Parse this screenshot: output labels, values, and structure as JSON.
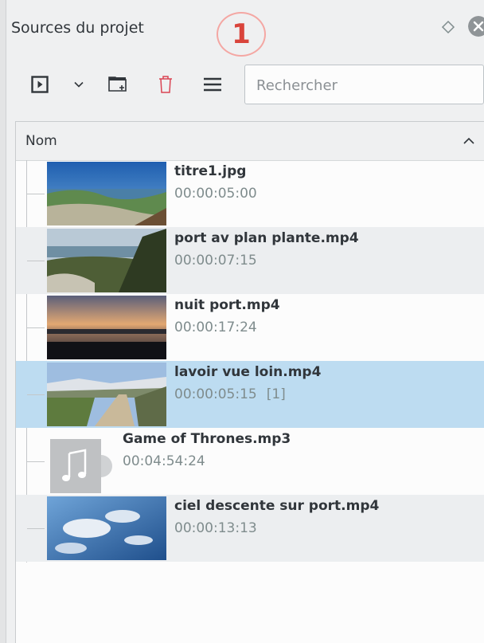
{
  "panel": {
    "title": "Sources du projet",
    "badge": "1"
  },
  "toolbar": {
    "search_placeholder": "Rechercher"
  },
  "list": {
    "header": "Nom",
    "items": [
      {
        "name": "titre1.jpg",
        "duration": "00:00:05:00",
        "tag": "",
        "type": "image",
        "selected": false
      },
      {
        "name": "port av plan plante.mp4",
        "duration": "00:00:07:15",
        "tag": "",
        "type": "video",
        "selected": false
      },
      {
        "name": "nuit port.mp4",
        "duration": "00:00:17:24",
        "tag": "",
        "type": "video",
        "selected": false
      },
      {
        "name": "lavoir vue loin.mp4",
        "duration": "00:00:05:15",
        "tag": "[1]",
        "type": "video",
        "selected": true
      },
      {
        "name": "Game of Thrones.mp3",
        "duration": "00:04:54:24",
        "tag": "",
        "type": "audio",
        "selected": false
      },
      {
        "name": "ciel descente sur port.mp4",
        "duration": "00:00:13:13",
        "tag": "",
        "type": "video",
        "selected": false
      }
    ]
  },
  "colors": {
    "selection": "#bddcf1",
    "badge": "#d9443b",
    "delete_icon": "#da4453"
  },
  "icons": [
    "play-clip-icon",
    "chevron-down-icon",
    "add-folder-icon",
    "trash-icon",
    "menu-icon",
    "float-icon",
    "close-icon",
    "sort-ascending-icon",
    "music-note-icon"
  ]
}
